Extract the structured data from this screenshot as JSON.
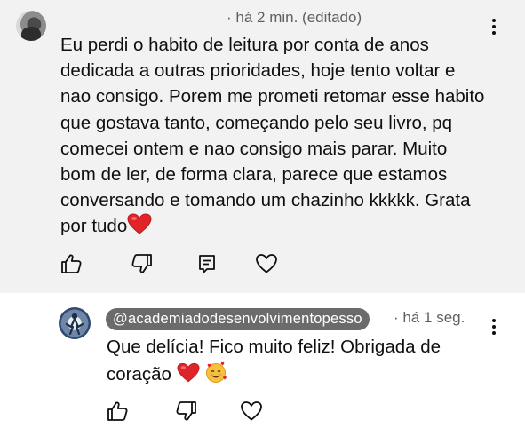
{
  "top_comment": {
    "meta": "· há 2 min. (editado)",
    "text_lines": [
      "Eu perdi o habito de leitura por conta de anos",
      "dedicada a outras prioridades, hoje tento voltar e",
      "nao consigo. Porem me prometi retomar esse habito",
      "que gostava tanto, começando pelo seu livro, pq",
      "comecei ontem e nao consigo mais parar. Muito",
      "bom de ler, de forma clara, parece que estamos",
      "conversando e tomando um chazinho kkkkk. Grata",
      "por tudo"
    ],
    "actions": [
      "like-icon",
      "dislike-icon",
      "reply-icon",
      "heart-outline-icon"
    ]
  },
  "reply_comment": {
    "handle": "@academiadodesenvolvimentopesso",
    "meta": "· há 1 seg.",
    "text_lines": [
      "Que delícia! Fico muito feliz! Obrigada de",
      "coração"
    ],
    "actions": [
      "like-icon",
      "dislike-icon",
      "heart-outline-icon"
    ]
  },
  "colors": {
    "top_background": "#f2f2f2",
    "handle_pill": "#6b6b6b",
    "meta_text": "#606060",
    "heart": "#e0252a"
  }
}
